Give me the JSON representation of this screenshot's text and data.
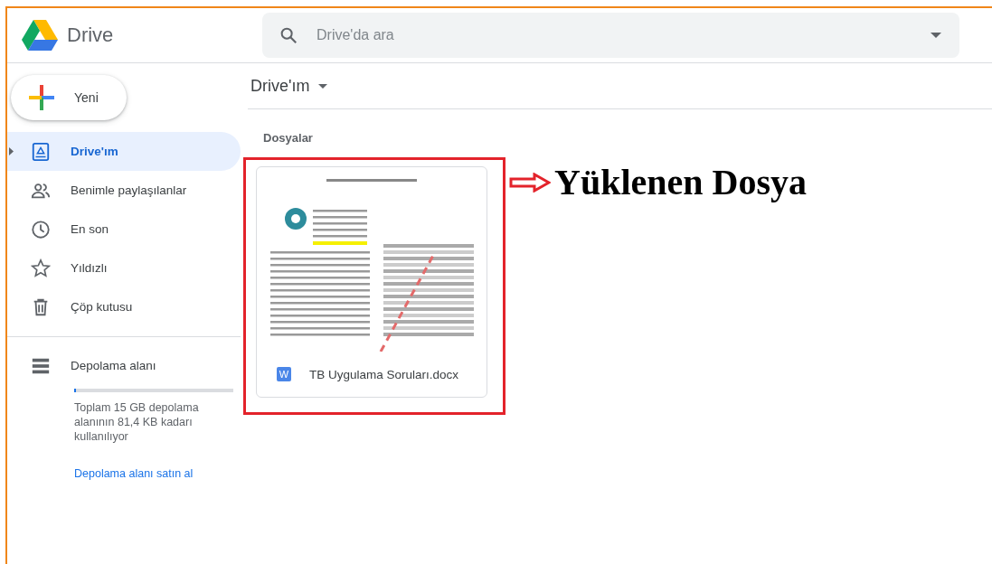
{
  "header": {
    "app_name": "Drive",
    "search": {
      "placeholder": "Drive'da ara"
    }
  },
  "sidebar": {
    "new_button": "Yeni",
    "items": [
      {
        "label": "Drive'ım",
        "kind": "drive",
        "selected": true
      },
      {
        "label": "Benimle paylaşılanlar",
        "kind": "people",
        "selected": false
      },
      {
        "label": "En son",
        "kind": "clock",
        "selected": false
      },
      {
        "label": "Yıldızlı",
        "kind": "star",
        "selected": false
      },
      {
        "label": "Çöp kutusu",
        "kind": "trash",
        "selected": false
      }
    ],
    "storage": {
      "label": "Depolama alanı",
      "level": 0.01,
      "usage": "Toplam 15 GB depolama alanının 81,4 KB kadarı kullanılıyor",
      "buy_link": "Depolama alanı satın al"
    }
  },
  "main": {
    "breadcrumb": "Drive'ım",
    "section": "Dosyalar",
    "files": [
      {
        "name": "TB Uygulama Soruları.docx",
        "type_badge": "W"
      }
    ]
  },
  "annotation": {
    "text": "Yüklenen Dosya"
  }
}
